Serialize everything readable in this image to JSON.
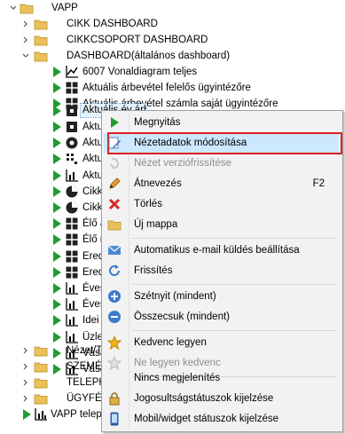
{
  "tree": {
    "root_label": "VAPP",
    "cikk_dashboard": "CIKK DASHBOARD",
    "cikkcsoport_dashboard": "CIKKCSOPORT DASHBOARD",
    "dashboard_altalanos": "DASHBOARD(általános dashboard)",
    "item_6007": "6007 Vonaldiagram teljes",
    "item_arbevetel_felelos": "Aktuális árbevétel felelős ügyintézőre",
    "item_arbevetel_szamla": "Aktuális árbevétel számla saját ügyintézőre",
    "item_aktualis_ev": "Aktuális év árbevétele",
    "partial_items": [
      "Aktu",
      "Aktu",
      "Aktu",
      "Aktu",
      "Cikk",
      "Cikk",
      "Élő a",
      "Élő r",
      "Ered",
      "Ered",
      "Éves",
      "Éves",
      "Idei",
      "Üzle",
      "Vásá",
      "Vásá"
    ],
    "nezet": "Nézet/T",
    "szemely": "SZEMÉLY",
    "telephe": "TELEPHE",
    "ugyfel": "ÜGYFÉL",
    "vapp_teleph": "VAPP teleph"
  },
  "context_menu": {
    "open": "Megnyitás",
    "edit_view_data": "Nézetadatok módosítása",
    "view_version_update": "Nézet verziófrissítése",
    "rename": "Átnevezés",
    "rename_shortcut": "F2",
    "delete": "Törlés",
    "new_folder": "Új mappa",
    "auto_email": "Automatikus e-mail küldés beállítása",
    "refresh": "Frissítés",
    "expand_all": "Szétnyit (mindent)",
    "collapse_all": "Összecsuk (mindent)",
    "favorite": "Kedvenc legyen",
    "not_favorite": "Ne legyen kedvenc",
    "no_display": "Nincs megjelenítés",
    "permission_status": "Jogosultságstátuszok kijelzése",
    "mobile_widget_status": "Mobil/widget státuszok kijelzése"
  },
  "colors": {
    "folder": "#e8c15a",
    "green_arrow": "#1f9d2f",
    "selection_outline": "#e02020",
    "selection_fill": "#cce8ff"
  }
}
